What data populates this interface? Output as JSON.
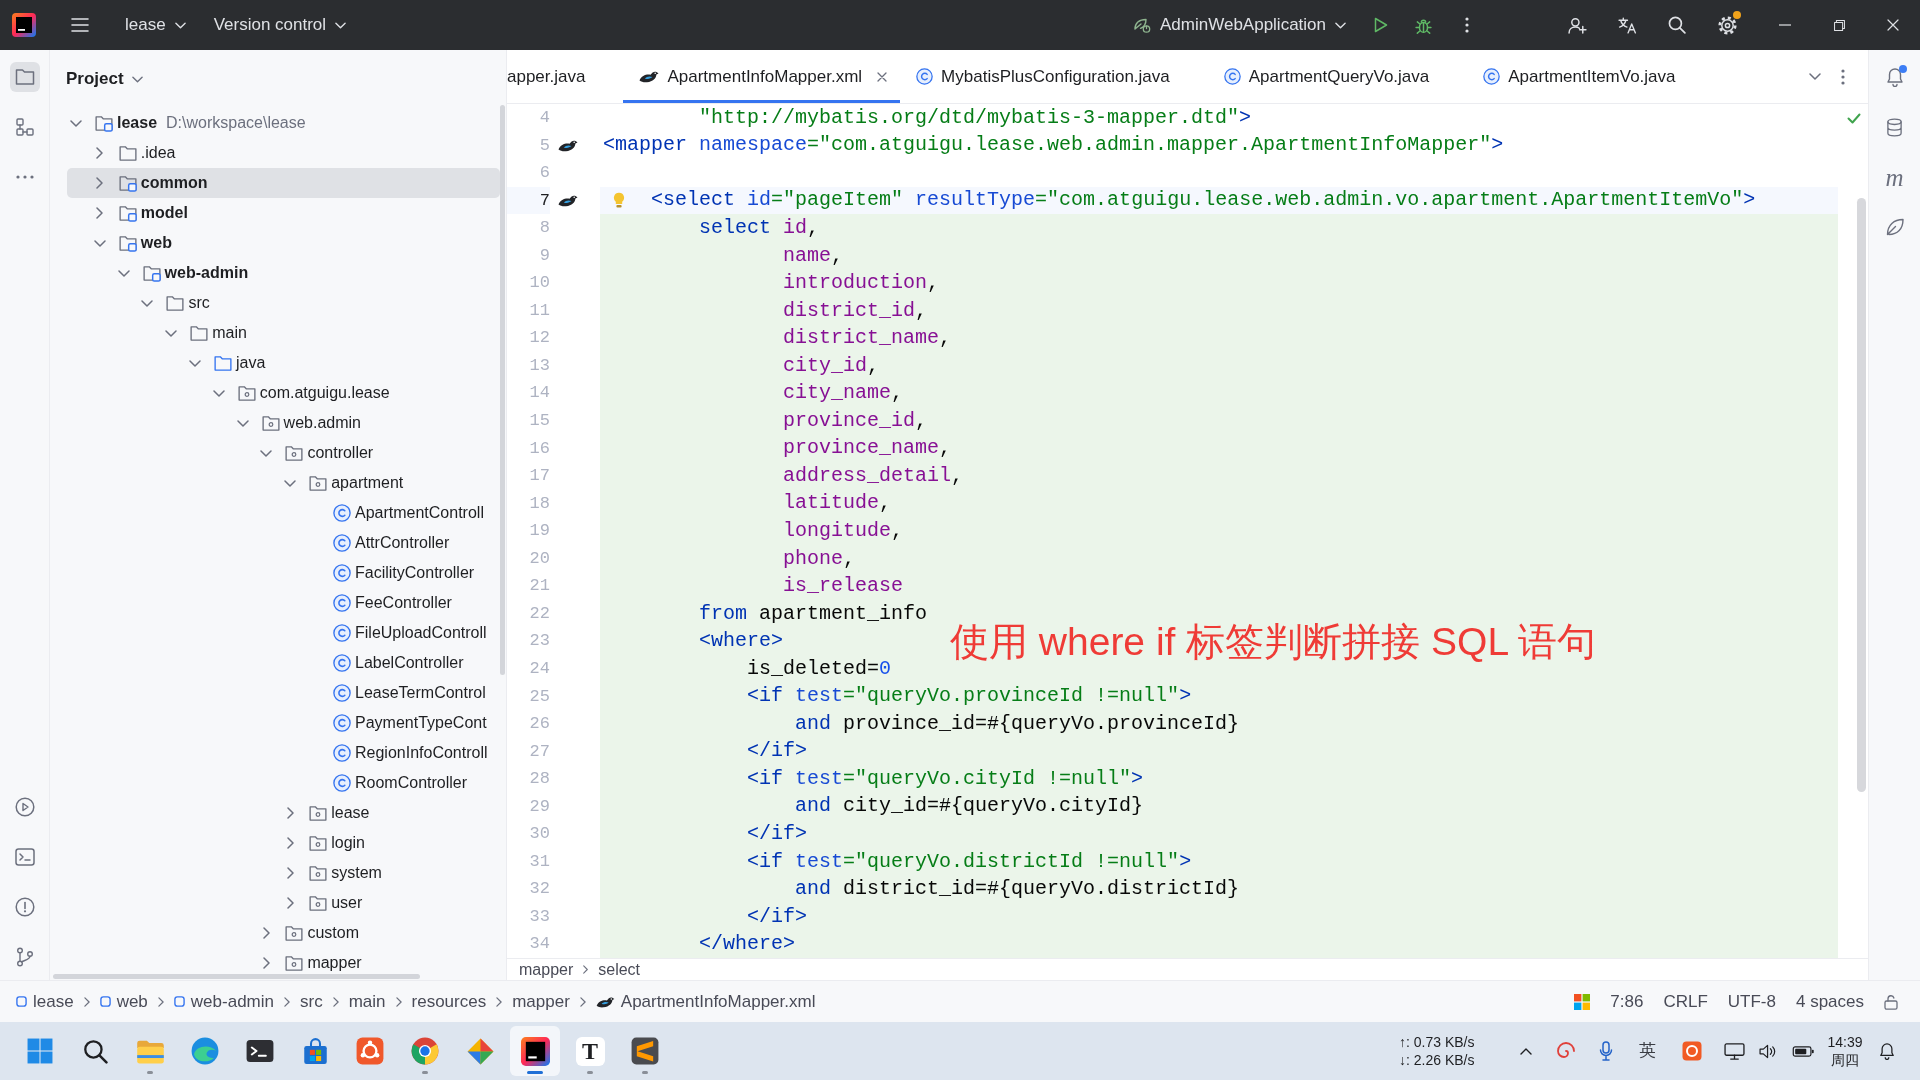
{
  "title_bar": {
    "project": "lease",
    "vcs": "Version control",
    "run_configuration": "AdminWebApplication",
    "update_badge": true
  },
  "left_toolbar": {
    "top": [
      {
        "kind": "project",
        "selected": true
      },
      {
        "kind": "structure",
        "selected": false
      },
      {
        "kind": "more",
        "selected": false
      }
    ],
    "bottom": [
      {
        "kind": "run",
        "selected": false
      },
      {
        "kind": "terminal",
        "selected": false
      },
      {
        "kind": "problems",
        "selected": false
      },
      {
        "kind": "git",
        "selected": false
      }
    ]
  },
  "project_panel": {
    "title": "Project",
    "tree": [
      {
        "label": "lease",
        "path": "D:\\workspace\\lease",
        "kind": "module",
        "expanded": true,
        "selected": false,
        "children": [
          {
            "label": ".idea",
            "kind": "folder",
            "expanded": false,
            "selected": false
          },
          {
            "label": "common",
            "kind": "module",
            "expanded": false,
            "selected": true
          },
          {
            "label": "model",
            "kind": "module",
            "expanded": false,
            "selected": false
          },
          {
            "label": "web",
            "kind": "module",
            "expanded": true,
            "selected": false,
            "children": [
              {
                "label": "web-admin",
                "kind": "module",
                "expanded": true,
                "selected": false,
                "children": [
                  {
                    "label": "src",
                    "kind": "folder",
                    "expanded": true,
                    "selected": false,
                    "children": [
                      {
                        "label": "main",
                        "kind": "folder",
                        "expanded": true,
                        "selected": false,
                        "children": [
                          {
                            "label": "java",
                            "kind": "source",
                            "expanded": true,
                            "selected": false,
                            "children": [
                              {
                                "label": "com.atguigu.lease",
                                "kind": "package",
                                "expanded": true,
                                "selected": false,
                                "children": [
                                  {
                                    "label": "web.admin",
                                    "kind": "package",
                                    "expanded": true,
                                    "selected": false,
                                    "children": [
                                      {
                                        "label": "controller",
                                        "kind": "package",
                                        "expanded": true,
                                        "selected": false,
                                        "children": [
                                          {
                                            "label": "apartment",
                                            "kind": "package",
                                            "expanded": true,
                                            "selected": false,
                                            "children": [
                                              {
                                                "label": "ApartmentControll",
                                                "kind": "class",
                                                "selected": false
                                              },
                                              {
                                                "label": "AttrController",
                                                "kind": "class",
                                                "selected": false
                                              },
                                              {
                                                "label": "FacilityController",
                                                "kind": "class",
                                                "selected": false
                                              },
                                              {
                                                "label": "FeeController",
                                                "kind": "class",
                                                "selected": false
                                              },
                                              {
                                                "label": "FileUploadControll",
                                                "kind": "class",
                                                "selected": false
                                              },
                                              {
                                                "label": "LabelController",
                                                "kind": "class",
                                                "selected": false
                                              },
                                              {
                                                "label": "LeaseTermControl",
                                                "kind": "class",
                                                "selected": false
                                              },
                                              {
                                                "label": "PaymentTypeCont",
                                                "kind": "class",
                                                "selected": false
                                              },
                                              {
                                                "label": "RegionInfoControll",
                                                "kind": "class",
                                                "selected": false
                                              },
                                              {
                                                "label": "RoomController",
                                                "kind": "class",
                                                "selected": false
                                              }
                                            ]
                                          },
                                          {
                                            "label": "lease",
                                            "kind": "package",
                                            "expanded": false,
                                            "selected": false
                                          },
                                          {
                                            "label": "login",
                                            "kind": "package",
                                            "expanded": false,
                                            "selected": false
                                          },
                                          {
                                            "label": "system",
                                            "kind": "package",
                                            "expanded": false,
                                            "selected": false
                                          },
                                          {
                                            "label": "user",
                                            "kind": "package",
                                            "expanded": false,
                                            "selected": false
                                          }
                                        ]
                                      },
                                      {
                                        "label": "custom",
                                        "kind": "package",
                                        "expanded": false,
                                        "selected": false
                                      },
                                      {
                                        "label": "mapper",
                                        "kind": "package",
                                        "expanded": false,
                                        "selected": false
                                      }
                                    ]
                                  }
                                ]
                              }
                            ]
                          }
                        ]
                      }
                    ]
                  }
                ]
              }
            ]
          }
        ]
      }
    ]
  },
  "editor": {
    "tabs": [
      {
        "label": "apper.java",
        "selected": false
      },
      {
        "label": "ApartmentInfoMapper.xml",
        "kind": "xml",
        "selected": true
      },
      {
        "label": "MybatisPlusConfiguration.java",
        "kind": "class",
        "selected": false
      },
      {
        "label": "ApartmentQueryVo.java",
        "kind": "class",
        "selected": false
      },
      {
        "label": "ApartmentItemVo.java",
        "kind": "class",
        "selected": false
      }
    ],
    "lines": [
      {
        "number": "4",
        "injected": false,
        "current": false,
        "tokens": [
          {
            "text": "        \"http://mybatis.org/dtd/mybatis-3-mapper.dtd\"",
            "kind": "value"
          },
          {
            "text": ">",
            "kind": "tag"
          }
        ]
      },
      {
        "number": "5",
        "injected": false,
        "current": false,
        "marker": true,
        "tokens": [
          {
            "text": "<mapper",
            "kind": "tag"
          },
          {
            "text": " namespace",
            "kind": "attr"
          },
          {
            "text": "=\"com.atguigu.lease.web.admin.mapper.ApartmentInfoMapper\"",
            "kind": "value"
          },
          {
            "text": ">",
            "kind": "tag"
          }
        ]
      },
      {
        "number": "6",
        "injected": false,
        "current": false
      },
      {
        "number": "7",
        "injected": false,
        "current": true,
        "marker": true,
        "intention": true,
        "tokens": [
          {
            "text": "    <select",
            "kind": "tag"
          },
          {
            "text": " id",
            "kind": "attr"
          },
          {
            "text": "=\"pageItem\"",
            "kind": "value"
          },
          {
            "text": " resultType",
            "kind": "attr"
          },
          {
            "text": "=\"com.atguigu.lease.web.admin.vo.apartment.ApartmentItemVo\"",
            "kind": "value"
          },
          {
            "text": ">",
            "kind": "tag"
          }
        ]
      },
      {
        "number": "8",
        "injected": true,
        "current": false,
        "tokens": [
          {
            "text": "        select",
            "kind": "keyword"
          },
          {
            "text": " id",
            "kind": "column"
          },
          {
            "text": ",",
            "kind": "text"
          }
        ]
      },
      {
        "number": "9",
        "injected": true,
        "current": false,
        "tokens": [
          {
            "text": "               name",
            "kind": "column"
          },
          {
            "text": ",",
            "kind": "text"
          }
        ]
      },
      {
        "number": "10",
        "injected": true,
        "current": false,
        "tokens": [
          {
            "text": "               introduction",
            "kind": "column"
          },
          {
            "text": ",",
            "kind": "text"
          }
        ]
      },
      {
        "number": "11",
        "injected": true,
        "current": false,
        "tokens": [
          {
            "text": "               district_id",
            "kind": "column"
          },
          {
            "text": ",",
            "kind": "text"
          }
        ]
      },
      {
        "number": "12",
        "injected": true,
        "current": false,
        "tokens": [
          {
            "text": "               district_name",
            "kind": "column"
          },
          {
            "text": ",",
            "kind": "text"
          }
        ]
      },
      {
        "number": "13",
        "injected": true,
        "current": false,
        "tokens": [
          {
            "text": "               city_id",
            "kind": "column"
          },
          {
            "text": ",",
            "kind": "text"
          }
        ]
      },
      {
        "number": "14",
        "injected": true,
        "current": false,
        "tokens": [
          {
            "text": "               city_name",
            "kind": "column"
          },
          {
            "text": ",",
            "kind": "text"
          }
        ]
      },
      {
        "number": "15",
        "injected": true,
        "current": false,
        "tokens": [
          {
            "text": "               province_id",
            "kind": "column"
          },
          {
            "text": ",",
            "kind": "text"
          }
        ]
      },
      {
        "number": "16",
        "injected": true,
        "current": false,
        "tokens": [
          {
            "text": "               province_name",
            "kind": "column"
          },
          {
            "text": ",",
            "kind": "text"
          }
        ]
      },
      {
        "number": "17",
        "injected": true,
        "current": false,
        "tokens": [
          {
            "text": "               address_detail",
            "kind": "column"
          },
          {
            "text": ",",
            "kind": "text"
          }
        ]
      },
      {
        "number": "18",
        "injected": true,
        "current": false,
        "tokens": [
          {
            "text": "               latitude",
            "kind": "column"
          },
          {
            "text": ",",
            "kind": "text"
          }
        ]
      },
      {
        "number": "19",
        "injected": true,
        "current": false,
        "tokens": [
          {
            "text": "               longitude",
            "kind": "column"
          },
          {
            "text": ",",
            "kind": "text"
          }
        ]
      },
      {
        "number": "20",
        "injected": true,
        "current": false,
        "tokens": [
          {
            "text": "               phone",
            "kind": "column"
          },
          {
            "text": ",",
            "kind": "text"
          }
        ]
      },
      {
        "number": "21",
        "injected": true,
        "current": false,
        "tokens": [
          {
            "text": "               is_release",
            "kind": "column"
          }
        ]
      },
      {
        "number": "22",
        "injected": true,
        "current": false,
        "tokens": [
          {
            "text": "        from",
            "kind": "keyword"
          },
          {
            "text": " apartment_info",
            "kind": "text"
          }
        ]
      },
      {
        "number": "23",
        "injected": true,
        "current": false,
        "tokens": [
          {
            "text": "        <where>",
            "kind": "tag"
          }
        ]
      },
      {
        "number": "24",
        "injected": true,
        "current": false,
        "tokens": [
          {
            "text": "            is_deleted=",
            "kind": "text"
          },
          {
            "text": "0",
            "kind": "number"
          }
        ]
      },
      {
        "number": "25",
        "injected": true,
        "current": false,
        "tokens": [
          {
            "text": "            <if",
            "kind": "tag"
          },
          {
            "text": " test",
            "kind": "attr"
          },
          {
            "text": "=\"queryVo.provinceId !=null\"",
            "kind": "value"
          },
          {
            "text": ">",
            "kind": "tag"
          }
        ]
      },
      {
        "number": "26",
        "injected": true,
        "current": false,
        "tokens": [
          {
            "text": "                and",
            "kind": "keyword"
          },
          {
            "text": " province_id=#{queryVo.provinceId}",
            "kind": "text"
          }
        ]
      },
      {
        "number": "27",
        "injected": true,
        "current": false,
        "tokens": [
          {
            "text": "            </if>",
            "kind": "tag"
          }
        ]
      },
      {
        "number": "28",
        "injected": true,
        "current": false,
        "tokens": [
          {
            "text": "            <if",
            "kind": "tag"
          },
          {
            "text": " test",
            "kind": "attr"
          },
          {
            "text": "=\"queryVo.cityId !=null\"",
            "kind": "value"
          },
          {
            "text": ">",
            "kind": "tag"
          }
        ]
      },
      {
        "number": "29",
        "injected": true,
        "current": false,
        "tokens": [
          {
            "text": "                and",
            "kind": "keyword"
          },
          {
            "text": " city_id=#{queryVo.cityId}",
            "kind": "text"
          }
        ]
      },
      {
        "number": "30",
        "injected": true,
        "current": false,
        "tokens": [
          {
            "text": "            </if>",
            "kind": "tag"
          }
        ]
      },
      {
        "number": "31",
        "injected": true,
        "current": false,
        "tokens": [
          {
            "text": "            <if",
            "kind": "tag"
          },
          {
            "text": " test",
            "kind": "attr"
          },
          {
            "text": "=\"queryVo.districtId !=null\"",
            "kind": "value"
          },
          {
            "text": ">",
            "kind": "tag"
          }
        ]
      },
      {
        "number": "32",
        "injected": true,
        "current": false,
        "tokens": [
          {
            "text": "                and",
            "kind": "keyword"
          },
          {
            "text": " district_id=#{queryVo.districtId}",
            "kind": "text"
          }
        ]
      },
      {
        "number": "33",
        "injected": true,
        "current": false,
        "tokens": [
          {
            "text": "            </if>",
            "kind": "tag"
          }
        ]
      },
      {
        "number": "34",
        "injected": true,
        "current": false,
        "tokens": [
          {
            "text": "        </where>",
            "kind": "tag"
          }
        ]
      }
    ],
    "breadcrumbs": [
      "mapper",
      "select"
    ],
    "caption": "使用 where if 标签判断拼接 SQL 语句"
  },
  "right_toolbar": {
    "label": "m",
    "notifications_badge": true
  },
  "status_bar": {
    "path": [
      {
        "label": "lease",
        "kind": "module"
      },
      {
        "label": "web",
        "kind": "module"
      },
      {
        "label": "web-admin",
        "kind": "module"
      },
      {
        "label": "src",
        "kind": "folder"
      },
      {
        "label": "main",
        "kind": "folder"
      },
      {
        "label": "resources",
        "kind": "folder"
      },
      {
        "label": "mapper",
        "kind": "folder"
      },
      {
        "label": "ApartmentInfoMapper.xml",
        "kind": "file"
      }
    ],
    "caret": "7:86",
    "line_separator": "CRLF",
    "encoding": "UTF-8",
    "indent": "4 spaces"
  },
  "taskbar": {
    "apps": [
      {
        "kind": "files",
        "running": true,
        "selected": false
      },
      {
        "kind": "edge",
        "running": false,
        "selected": false
      },
      {
        "kind": "terminal",
        "running": false,
        "selected": false
      },
      {
        "kind": "store",
        "running": false,
        "selected": false
      },
      {
        "kind": "ring",
        "running": false,
        "selected": false
      },
      {
        "kind": "chrome",
        "running": true,
        "selected": false
      },
      {
        "kind": "diamond",
        "running": false,
        "selected": false
      },
      {
        "kind": "ide",
        "running": true,
        "selected": true
      },
      {
        "kind": "letter",
        "text": "T",
        "running": true,
        "selected": false
      },
      {
        "kind": "sublime",
        "running": true,
        "selected": false
      }
    ],
    "upload": "↑: 0.73 KB/s",
    "download": "↓: 2.26 KB/s",
    "input_method": "英",
    "time": "14:39",
    "day": "周四"
  }
}
